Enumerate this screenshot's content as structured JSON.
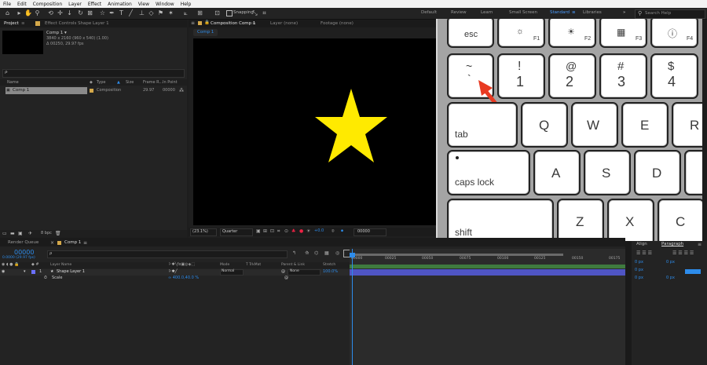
{
  "menu": [
    "File",
    "Edit",
    "Composition",
    "Layer",
    "Effect",
    "Animation",
    "View",
    "Window",
    "Help"
  ],
  "toolbar": {
    "snapping": "Snapping",
    "workspaces": [
      "Default",
      "Review",
      "Learn",
      "Small Screen",
      "Standard",
      "Libraries"
    ],
    "active_workspace": "Standard",
    "search_placeholder": "Search Help"
  },
  "project": {
    "tab": "Project",
    "effect_tab": "Effect Controls  Shape Layer 1",
    "item_name": "Comp 1 ▾",
    "item_info1": "3840 x 2160  (960 x 540) (1.00)",
    "item_info2": "Δ 00250, 29.97 fps",
    "search_glyph": "ρ̵",
    "col_name": "Name",
    "col_type": "Type",
    "col_size": "Size",
    "col_frame": "Frame R...",
    "col_inpoint": "In Point",
    "row_name": "Comp 1",
    "row_type": "Composition",
    "row_frame": "29.97",
    "row_in": "00000",
    "bpc": "8 bpc"
  },
  "composition": {
    "tab": "Composition  Comp 1",
    "layer_tab": "Layer  (none)",
    "footage_tab": "Footage  (none)",
    "breadcrumb": "Comp 1",
    "zoom": "(23.1%)",
    "resolution": "Quarter",
    "exposure": "+0.0",
    "timecode": "00000"
  },
  "timeline": {
    "render_queue": "Render Queue",
    "comp_tab": "Comp 1",
    "current_time": "00000",
    "fps": "0.0000 (29.97 fps)",
    "search_glyph": "ρ̵",
    "col_layer_name": "Layer Name",
    "col_mode": "Mode",
    "col_trkmat": "T  TrkMat",
    "col_parent": "Parent & Link",
    "col_stretch": "Stretch",
    "layer_num": "1",
    "layer_name": "Shape Layer 1",
    "layer_mode": "Normal",
    "layer_parent": "None",
    "layer_stretch": "100.0%",
    "prop_name": "Scale",
    "prop_value": "∞ 400.0,40.0 %",
    "ruler": [
      "00000",
      "00025",
      "00050",
      "00075",
      "00100",
      "00125",
      "00150",
      "00175"
    ]
  },
  "right": {
    "align": "Align",
    "paragraph": "Paragraph",
    "px_values": [
      "0 px",
      "0 px",
      "0 px",
      "0 px",
      "0 px"
    ]
  },
  "keyboard": {
    "row0": [
      {
        "label": "esc"
      },
      {
        "label": "☼",
        "fn": "F1"
      },
      {
        "label": "☀",
        "fn": "F2"
      },
      {
        "label": "▦",
        "fn": "F3"
      },
      {
        "label": "ⓘ",
        "fn": "F4"
      }
    ],
    "row1": [
      {
        "top": "~",
        "bottom": "`"
      },
      {
        "top": "!",
        "bottom": "1"
      },
      {
        "top": "@",
        "bottom": "2"
      },
      {
        "top": "#",
        "bottom": "3"
      },
      {
        "top": "$",
        "bottom": "4"
      }
    ],
    "row2": [
      {
        "label": "tab"
      },
      {
        "label": "Q"
      },
      {
        "label": "W"
      },
      {
        "label": "E"
      },
      {
        "label": "R"
      }
    ],
    "row3": [
      {
        "label": "caps lock"
      },
      {
        "label": "A"
      },
      {
        "label": "S"
      },
      {
        "label": "D"
      }
    ],
    "row4": [
      {
        "label": "shift"
      },
      {
        "label": "Z"
      },
      {
        "label": "X"
      },
      {
        "label": "C"
      }
    ]
  },
  "colors": {
    "accent": "#2d8ceb",
    "star": "#ffea00",
    "arrow": "#e83a22",
    "label_color": "#6b70ff"
  }
}
